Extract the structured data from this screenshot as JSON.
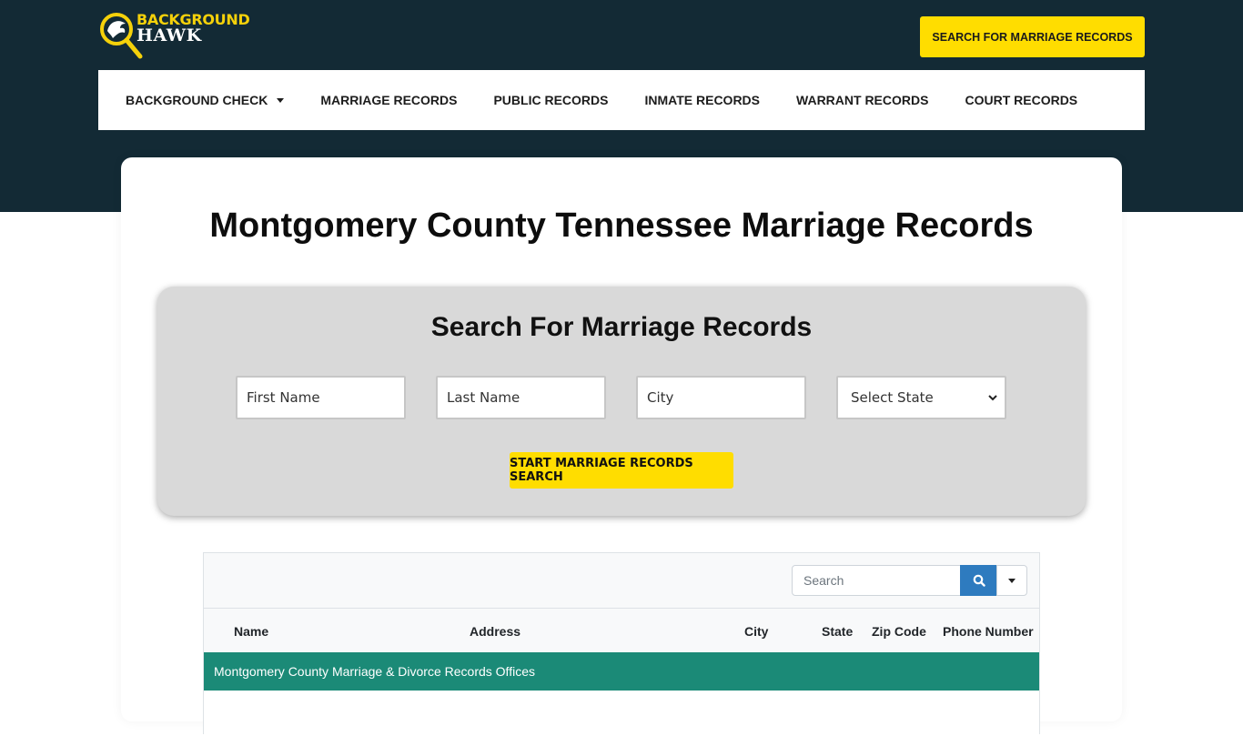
{
  "header": {
    "logo": {
      "line1": "BACKGROUND",
      "line2": "HAWK",
      "icon": "hawk-magnifier-icon"
    },
    "cta_label": "SEARCH FOR MARRIAGE RECORDS"
  },
  "nav": {
    "items": [
      {
        "label": "BACKGROUND CHECK",
        "has_dropdown": true
      },
      {
        "label": "MARRIAGE RECORDS"
      },
      {
        "label": "PUBLIC RECORDS"
      },
      {
        "label": "INMATE RECORDS"
      },
      {
        "label": "WARRANT RECORDS"
      },
      {
        "label": "COURT RECORDS"
      }
    ]
  },
  "main": {
    "title": "Montgomery County Tennessee Marriage Records"
  },
  "search_form": {
    "title": "Search For Marriage Records",
    "first_name_placeholder": "First Name",
    "last_name_placeholder": "Last Name",
    "city_placeholder": "City",
    "state_selected": "Select State",
    "submit_label": "START MARRIAGE RECORDS SEARCH"
  },
  "table": {
    "search_placeholder": "Search",
    "search_icon": "search-icon",
    "columns": [
      "Name",
      "Address",
      "City",
      "State",
      "Zip Code",
      "Phone Number"
    ],
    "group_row": "Montgomery County Marriage & Divorce Records Offices"
  },
  "colors": {
    "header_bg": "#132a35",
    "accent_yellow": "#ffdd00",
    "group_row_green": "#1b8a77",
    "search_button_blue": "#2e7bbf"
  }
}
